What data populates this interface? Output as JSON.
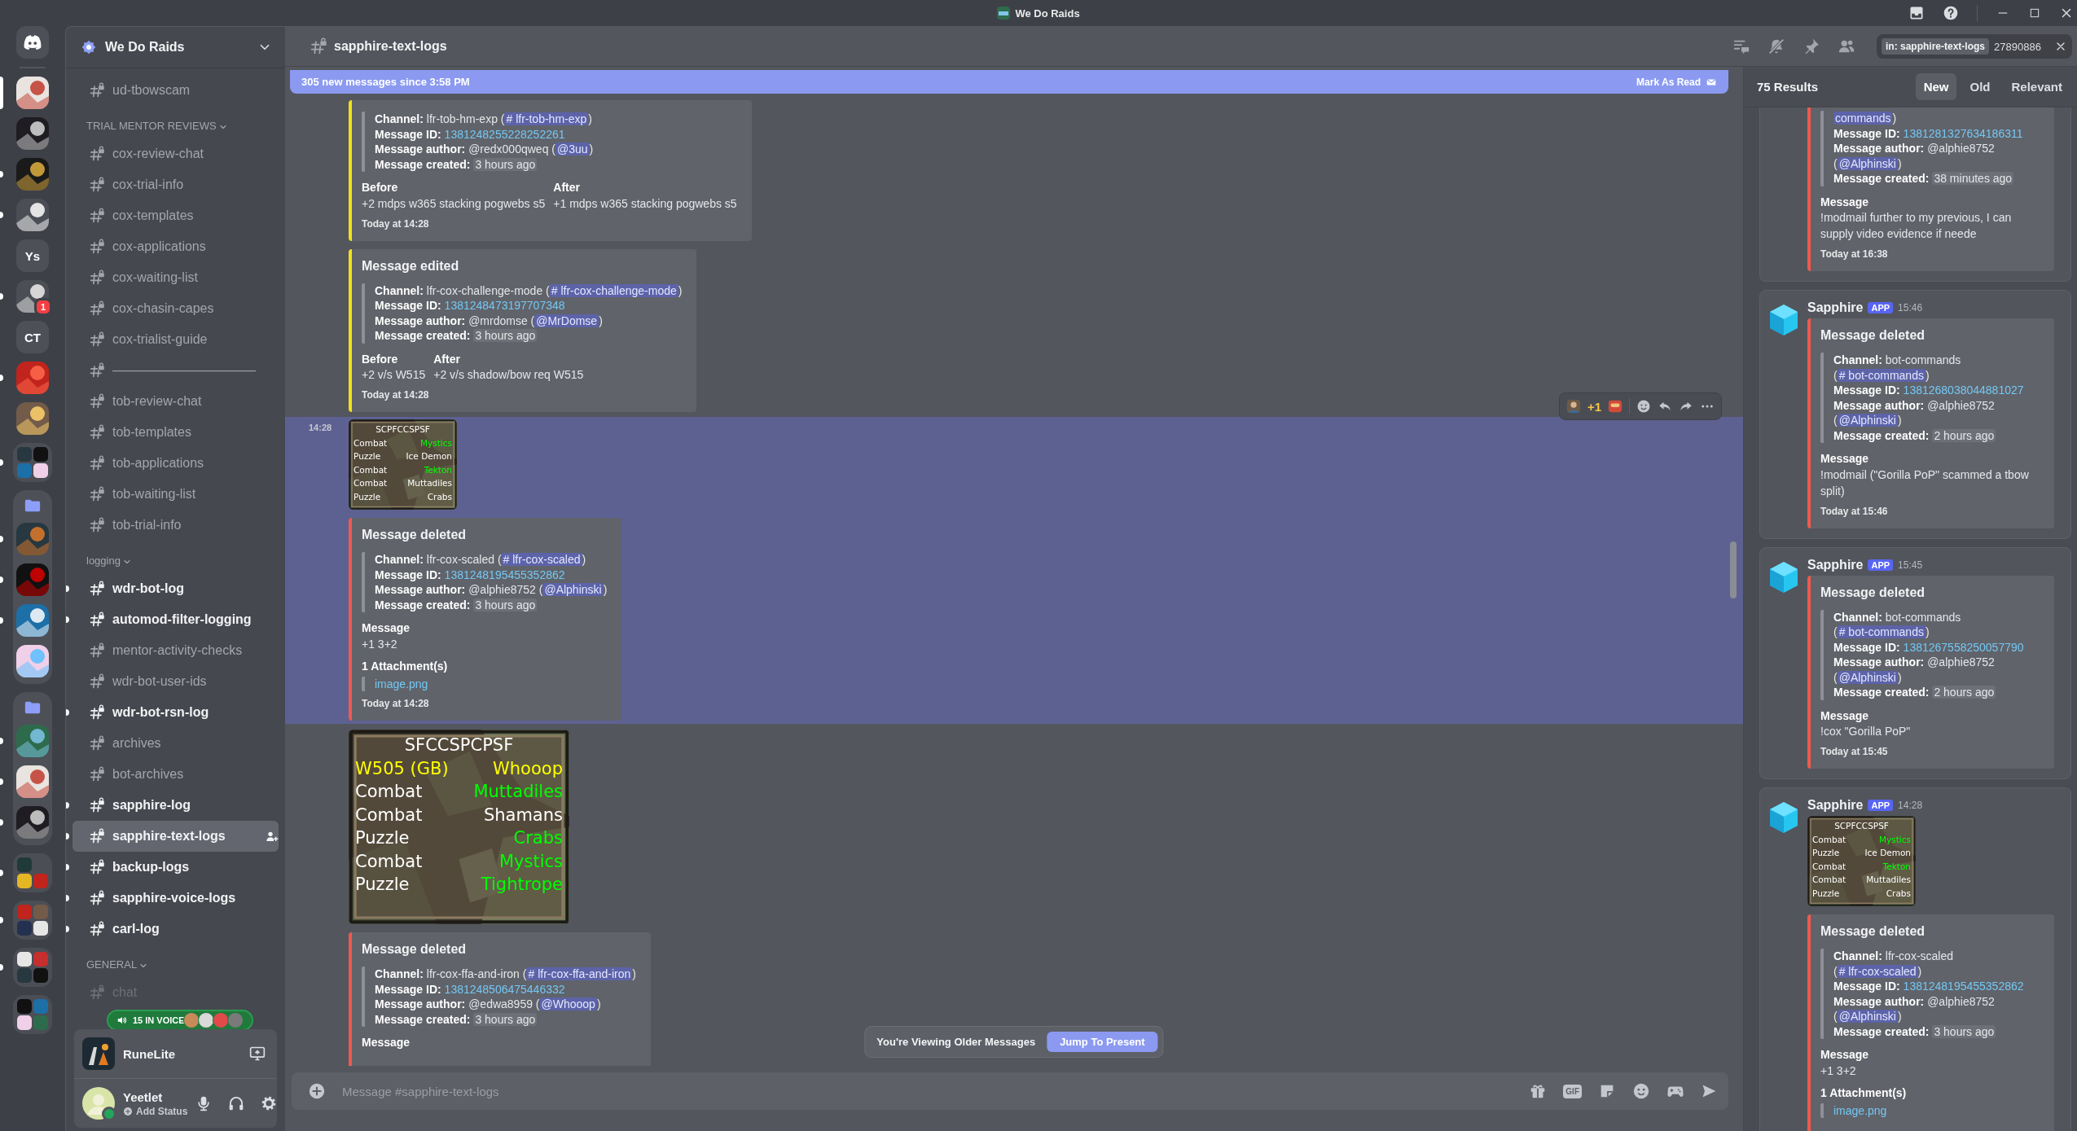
{
  "titlebar": {
    "title": "We Do Raids"
  },
  "servers": [
    {
      "kind": "home",
      "selected": false,
      "unread": false
    },
    {
      "kind": "avatar",
      "selected": true
    },
    {
      "kind": "avatar",
      "selected": false,
      "unread": false
    },
    {
      "kind": "avatar",
      "selected": false,
      "unread": true
    },
    {
      "kind": "avatar",
      "selected": false,
      "unread": true
    },
    {
      "kind": "text",
      "label": "Ys",
      "selected": false,
      "unread": false
    },
    {
      "kind": "avatar",
      "selected": false,
      "unread": true,
      "badge": "1"
    },
    {
      "kind": "text",
      "label": "CT",
      "selected": false,
      "unread": false
    },
    {
      "kind": "avatar",
      "selected": false,
      "unread": true
    },
    {
      "kind": "avatar",
      "selected": false,
      "unread": false
    },
    {
      "kind": "group",
      "selected": false,
      "unread": true
    },
    {
      "kind": "folder",
      "selected": false,
      "unread": false,
      "children": [
        {
          "kind": "avatar",
          "selected": false,
          "unread": true
        },
        {
          "kind": "avatar",
          "selected": false,
          "unread": true
        },
        {
          "kind": "avatar",
          "selected": false,
          "unread": true
        },
        {
          "kind": "avatar",
          "selected": false,
          "unread": false
        }
      ]
    },
    {
      "kind": "folder",
      "selected": false,
      "unread": false,
      "children": [
        {
          "kind": "avatar",
          "selected": false,
          "unread": true
        },
        {
          "kind": "avatar",
          "selected": false,
          "unread": true
        },
        {
          "kind": "avatar",
          "selected": false,
          "unread": true
        }
      ]
    },
    {
      "kind": "group",
      "selected": false,
      "unread": true
    },
    {
      "kind": "group",
      "selected": false,
      "unread": true
    },
    {
      "kind": "group",
      "selected": false,
      "unread": true
    },
    {
      "kind": "group",
      "selected": false,
      "unread": false
    }
  ],
  "server": {
    "name": "We Do Raids"
  },
  "channels": [
    {
      "kind": "channel",
      "name": "ud-tbowscam",
      "locked": true,
      "unread": false,
      "selected": false,
      "muted": false
    },
    {
      "kind": "category",
      "label": "TRIAL MENTOR REVIEWS"
    },
    {
      "kind": "channel",
      "name": "cox-review-chat",
      "locked": true,
      "unread": false,
      "selected": false,
      "muted": false
    },
    {
      "kind": "channel",
      "name": "cox-trial-info",
      "locked": true,
      "unread": false,
      "selected": false,
      "muted": false
    },
    {
      "kind": "channel",
      "name": "cox-templates",
      "locked": true,
      "unread": false,
      "selected": false,
      "muted": false
    },
    {
      "kind": "channel",
      "name": "cox-applications",
      "locked": true,
      "unread": false,
      "selected": false,
      "muted": false
    },
    {
      "kind": "channel",
      "name": "cox-waiting-list",
      "locked": true,
      "unread": false,
      "selected": false,
      "muted": false
    },
    {
      "kind": "channel",
      "name": "cox-chasin-capes",
      "locked": true,
      "unread": false,
      "selected": false,
      "muted": false
    },
    {
      "kind": "channel",
      "name": "cox-trialist-guide",
      "locked": true,
      "unread": false,
      "selected": false,
      "muted": false
    },
    {
      "kind": "channel",
      "name": "———————————",
      "locked": true,
      "unread": false,
      "selected": false,
      "muted": false
    },
    {
      "kind": "channel",
      "name": "tob-review-chat",
      "locked": true,
      "unread": false,
      "selected": false,
      "muted": false
    },
    {
      "kind": "channel",
      "name": "tob-templates",
      "locked": true,
      "unread": false,
      "selected": false,
      "muted": false
    },
    {
      "kind": "channel",
      "name": "tob-applications",
      "locked": true,
      "unread": false,
      "selected": false,
      "muted": false
    },
    {
      "kind": "channel",
      "name": "tob-waiting-list",
      "locked": true,
      "unread": false,
      "selected": false,
      "muted": false
    },
    {
      "kind": "channel",
      "name": "tob-trial-info",
      "locked": true,
      "unread": false,
      "selected": false,
      "muted": false
    },
    {
      "kind": "category",
      "label": "logging"
    },
    {
      "kind": "channel",
      "name": "wdr-bot-log",
      "locked": true,
      "unread": true,
      "selected": false,
      "muted": false
    },
    {
      "kind": "channel",
      "name": "automod-filter-logging",
      "locked": true,
      "unread": true,
      "selected": false,
      "muted": false
    },
    {
      "kind": "channel",
      "name": "mentor-activity-checks",
      "locked": true,
      "unread": false,
      "selected": false,
      "muted": false
    },
    {
      "kind": "channel",
      "name": "wdr-bot-user-ids",
      "locked": true,
      "unread": false,
      "selected": false,
      "muted": false
    },
    {
      "kind": "channel",
      "name": "wdr-bot-rsn-log",
      "locked": true,
      "unread": true,
      "selected": false,
      "muted": false
    },
    {
      "kind": "channel",
      "name": "archives",
      "locked": true,
      "unread": false,
      "selected": false,
      "muted": false
    },
    {
      "kind": "channel",
      "name": "bot-archives",
      "locked": true,
      "unread": false,
      "selected": false,
      "muted": false
    },
    {
      "kind": "channel",
      "name": "sapphire-log",
      "locked": true,
      "unread": true,
      "selected": false,
      "muted": false
    },
    {
      "kind": "channel",
      "name": "sapphire-text-logs",
      "locked": true,
      "unread": true,
      "selected": true,
      "muted": false
    },
    {
      "kind": "channel",
      "name": "backup-logs",
      "locked": true,
      "unread": true,
      "selected": false,
      "muted": false
    },
    {
      "kind": "channel",
      "name": "sapphire-voice-logs",
      "locked": true,
      "unread": true,
      "selected": false,
      "muted": false
    },
    {
      "kind": "channel",
      "name": "carl-log",
      "locked": true,
      "unread": true,
      "selected": false,
      "muted": false
    },
    {
      "kind": "category",
      "label": "GENERAL"
    },
    {
      "kind": "channel",
      "name": "chat",
      "locked": true,
      "unread": false,
      "selected": false,
      "muted": true
    }
  ],
  "voice": {
    "label": "15 IN VOICE"
  },
  "activity": {
    "name": "RuneLite"
  },
  "user": {
    "name": "Yeetlet",
    "status_text": "Add Status",
    "online": true
  },
  "header": {
    "channel": "sapphire-text-logs",
    "search": {
      "filter": "in: sapphire-text-logs",
      "value": "27890886"
    }
  },
  "new_messages": {
    "text": "305 new messages since 3:58 PM",
    "action": "Mark As Read"
  },
  "messages": [
    {
      "hovered": false,
      "blocks": [
        {
          "kind": "embed",
          "color": "#f0e21a",
          "fields": [
            {
              "label": "Channel:",
              "value": "lfr-tob-hm-exp (",
              "mention": "# lfr-tob-hm-exp",
              "tail": ")"
            },
            {
              "label": "Message ID:",
              "link": "1381248255228252261"
            },
            {
              "label": "Message author:",
              "value": "@redx000qweq (",
              "mention": "@3uu",
              "tail": ")"
            },
            {
              "label": "Message created:",
              "chip": "3 hours ago"
            }
          ],
          "diff": [
            {
              "label": "Before",
              "text": "+2 mdps w365 stacking pogwebs s5"
            },
            {
              "label": "After",
              "text": "+1 mdps w365 stacking pogwebs s5"
            }
          ],
          "footer": "Today at 14:28"
        },
        {
          "kind": "embed",
          "color": "#f0e21a",
          "title": "Message edited",
          "fields": [
            {
              "label": "Channel:",
              "value": "lfr-cox-challenge-mode (",
              "mention": "# lfr-cox-challenge-mode",
              "tail": ")"
            },
            {
              "label": "Message ID:",
              "link": "1381248473197707348"
            },
            {
              "label": "Message author:",
              "value": "@mrdomse (",
              "mention": "@MrDomse",
              "tail": ")"
            },
            {
              "label": "Message created:",
              "chip": "3 hours ago"
            }
          ],
          "diff": [
            {
              "label": "Before",
              "text": "+2 v/s W515"
            },
            {
              "label": "After",
              "text": "+2 v/s shadow/bow req W515"
            }
          ],
          "footer": "Today at 14:28"
        }
      ]
    },
    {
      "hovered": true,
      "time": "14:28",
      "toolbar": {
        "reaction_label": "+1"
      },
      "blocks": [
        {
          "kind": "thumbnail",
          "title": "SCPFCCSPSF",
          "rows": [
            {
              "left": {
                "text": "Combat",
                "color": "#ffffff"
              },
              "right": {
                "text": "Mystics",
                "color": "#00ff00"
              }
            },
            {
              "left": {
                "text": "Puzzle",
                "color": "#ffffff"
              },
              "right": {
                "text": "Ice Demon",
                "color": "#ffffff"
              }
            },
            {
              "left": {
                "text": "Combat",
                "color": "#ffffff"
              },
              "right": {
                "text": "Tekton",
                "color": "#00ff00"
              }
            },
            {
              "left": {
                "text": "Combat",
                "color": "#ffffff"
              },
              "right": {
                "text": "Muttadiles",
                "color": "#ffffff"
              }
            },
            {
              "left": {
                "text": "Puzzle",
                "color": "#ffffff"
              },
              "right": {
                "text": "Crabs",
                "color": "#ffffff"
              }
            }
          ]
        },
        {
          "kind": "embed",
          "color": "#f05a4f",
          "title": "Message deleted",
          "fields": [
            {
              "label": "Channel:",
              "value": "lfr-cox-scaled (",
              "mention": "# lfr-cox-scaled",
              "tail": ")"
            },
            {
              "label": "Message ID:",
              "link": "1381248195455352862"
            },
            {
              "label": "Message author:",
              "value": "@alphie8752 (",
              "mention": "@Alphinski",
              "tail": ")"
            },
            {
              "label": "Message created:",
              "chip": "3 hours ago"
            }
          ],
          "message": {
            "label": "Message",
            "text": "+1 3+2"
          },
          "attachments": {
            "label": "1 Attachment(s)",
            "files": [
              "image.png"
            ]
          },
          "footer": "Today at 14:28"
        }
      ]
    },
    {
      "hovered": false,
      "blocks": [
        {
          "title": "SFCCSPCPSF",
          "rows": [
            {
              "left": {
                "text": "W505 (GB)",
                "color": "#ffff00"
              },
              "right": {
                "text": "Whooop",
                "color": "#ffff00"
              }
            },
            {
              "left": {
                "text": "Combat",
                "color": "#ffffff"
              },
              "right": {
                "text": "Muttadiles",
                "color": "#00ff00"
              }
            },
            {
              "left": {
                "text": "Combat",
                "color": "#ffffff"
              },
              "right": {
                "text": "Shamans",
                "color": "#ffffff"
              }
            },
            {
              "left": {
                "text": "Puzzle",
                "color": "#ffffff"
              },
              "right": {
                "text": "Crabs",
                "color": "#00ff00"
              }
            },
            {
              "left": {
                "text": "Combat",
                "color": "#ffffff"
              },
              "right": {
                "text": "Mystics",
                "color": "#00ff00"
              }
            },
            {
              "left": {
                "text": "Puzzle",
                "color": "#ffffff"
              },
              "right": {
                "text": "Tightrope",
                "color": "#00ff00"
              }
            }
          ]
        },
        {
          "kind": "embed",
          "color": "#f05a4f",
          "title": "Message deleted",
          "fields": [
            {
              "label": "Channel:",
              "value": "lfr-cox-ffa-and-iron (",
              "mention": "# lfr-cox-ffa-and-iron",
              "tail": ")"
            },
            {
              "label": "Message ID:",
              "link": "1381248506475446332"
            },
            {
              "label": "Message author:",
              "value": "@edwa8959 (",
              "mention": "@Whooop",
              "tail": ")"
            },
            {
              "label": "Message created:",
              "chip": "3 hours ago"
            }
          ],
          "message": {
            "label": "Message"
          }
        }
      ]
    }
  ],
  "older_notice": {
    "text": "You're Viewing Older Messages",
    "action": "Jump To Present"
  },
  "composer": {
    "placeholder": "Message #sapphire-text-logs",
    "gif_label": "GIF"
  },
  "search_results": {
    "count": "75 Results",
    "sorts": [
      {
        "label": "New",
        "selected": true
      },
      {
        "label": "Old",
        "selected": false
      },
      {
        "label": "Relevant",
        "selected": false
      }
    ],
    "results": [
      {
        "blocks": [
          {
            "kind": "embed",
            "color": "#f05a4f",
            "fields": [
              {
                "mention": "commands",
                "tail": ")"
              },
              {
                "label": "Message ID:",
                "link": "1381281327634186311"
              },
              {
                "label": "Message author:",
                "value": "@alphie8752 (",
                "mention": "@Alphinski",
                "tail": ")"
              },
              {
                "label": "Message created:",
                "chip": "38 minutes ago"
              }
            ],
            "message": {
              "label": "Message",
              "text": "!modmail further to my previous, I can supply video evidence if neede"
            },
            "footer": "Today at 16:38"
          }
        ]
      },
      {
        "author": "Sapphire",
        "tag": "APP",
        "time": "15:46",
        "blocks": [
          {
            "kind": "embed",
            "color": "#f05a4f",
            "title": "Message deleted",
            "fields": [
              {
                "label": "Channel:",
                "value": "bot-commands (",
                "mention": "# bot-commands",
                "tail": ")"
              },
              {
                "label": "Message ID:",
                "link": "1381268038044881027"
              },
              {
                "label": "Message author:",
                "value": "@alphie8752 (",
                "mention": "@Alphinski",
                "tail": ")"
              },
              {
                "label": "Message created:",
                "chip": "2 hours ago"
              }
            ],
            "message": {
              "label": "Message",
              "text": "!modmail (\"Gorilla PoP\" scammed a tbow split)"
            },
            "footer": "Today at 15:46"
          }
        ]
      },
      {
        "author": "Sapphire",
        "tag": "APP",
        "time": "15:45",
        "blocks": [
          {
            "kind": "embed",
            "color": "#f05a4f",
            "title": "Message deleted",
            "fields": [
              {
                "label": "Channel:",
                "value": "bot-commands (",
                "mention": "# bot-commands",
                "tail": ")"
              },
              {
                "label": "Message ID:",
                "link": "1381267558250057790"
              },
              {
                "label": "Message author:",
                "value": "@alphie8752 (",
                "mention": "@Alphinski",
                "tail": ")"
              },
              {
                "label": "Message created:",
                "chip": "2 hours ago"
              }
            ],
            "message": {
              "label": "Message",
              "text": "!cox \"Gorilla PoP\""
            },
            "footer": "Today at 15:45"
          }
        ]
      },
      {
        "author": "Sapphire",
        "tag": "APP",
        "time": "14:28",
        "blocks": [
          {
            "kind": "thumbnail",
            "title": "SCPFCCSPSF",
            "rows": [
              {
                "left": {
                  "text": "Combat",
                  "color": "#ffffff"
                },
                "right": {
                  "text": "Mystics",
                  "color": "#00ff00"
                }
              },
              {
                "left": {
                  "text": "Puzzle",
                  "color": "#ffffff"
                },
                "right": {
                  "text": "Ice Demon",
                  "color": "#ffffff"
                }
              },
              {
                "left": {
                  "text": "Combat",
                  "color": "#ffffff"
                },
                "right": {
                  "text": "Tekton",
                  "color": "#00ff00"
                }
              },
              {
                "left": {
                  "text": "Combat",
                  "color": "#ffffff"
                },
                "right": {
                  "text": "Muttadiles",
                  "color": "#ffffff"
                }
              },
              {
                "left": {
                  "text": "Puzzle",
                  "color": "#ffffff"
                },
                "right": {
                  "text": "Crabs",
                  "color": "#ffffff"
                }
              }
            ]
          },
          {
            "kind": "embed",
            "color": "#f05a4f",
            "title": "Message deleted",
            "fields": [
              {
                "label": "Channel:",
                "value": "lfr-cox-scaled (",
                "mention": "# lfr-cox-scaled",
                "tail": ")"
              },
              {
                "label": "Message ID:",
                "link": "1381248195455352862"
              },
              {
                "label": "Message author:",
                "value": "@alphie8752 (",
                "mention": "@Alphinski",
                "tail": ")"
              },
              {
                "label": "Message created:",
                "chip": "3 hours ago"
              }
            ],
            "message": {
              "label": "Message",
              "text": "+1 3+2"
            },
            "attachments": {
              "label": "1 Attachment(s)",
              "files": [
                "image.png"
              ]
            }
          }
        ]
      }
    ]
  }
}
